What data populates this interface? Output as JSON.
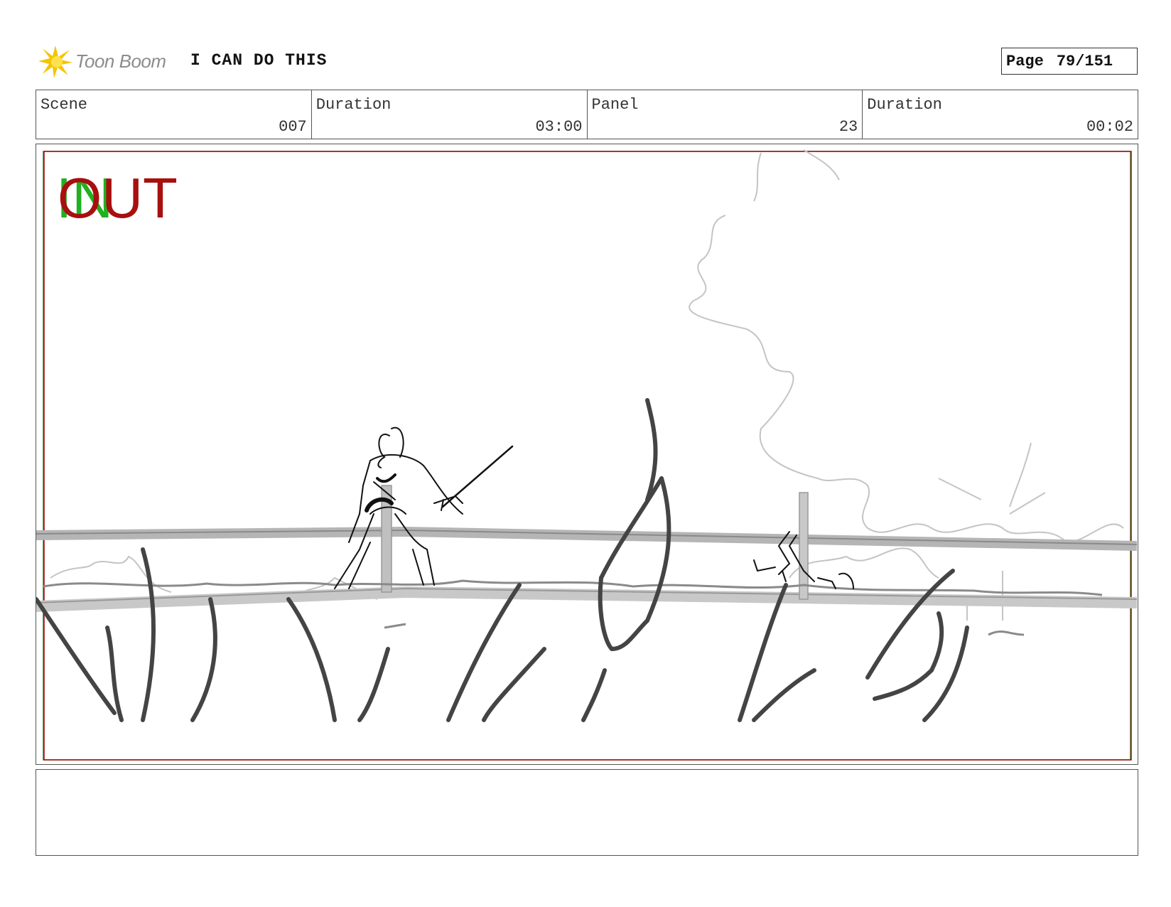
{
  "header": {
    "logo_text": "Toon Boom",
    "project_title": "I CAN DO THIS",
    "page_label": "Page",
    "page_number": "79/151"
  },
  "info": {
    "scene_label": "Scene",
    "scene_value": "007",
    "scene_duration_label": "Duration",
    "scene_duration_value": "03:00",
    "panel_label": "Panel",
    "panel_value": "23",
    "panel_duration_label": "Duration",
    "panel_duration_value": "00:02"
  },
  "panel": {
    "in_marker": "IN",
    "out_marker": "OUT",
    "in_color": "#22b022",
    "out_color": "#a80f0f"
  },
  "notes": {
    "text": ""
  }
}
